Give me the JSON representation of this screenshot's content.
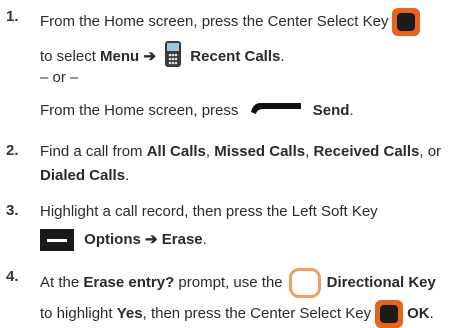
{
  "steps": [
    {
      "number": "1.",
      "line1": {
        "pre": "From the Home screen, press the Center Select Key"
      },
      "line2": {
        "pre": "to select ",
        "menu": "Menu",
        "arrow": "➔",
        "recent": "Recent Calls",
        "post": "."
      },
      "or": "– or –",
      "line4": {
        "pre": "From the Home screen, press",
        "send": "Send",
        "post": "."
      }
    },
    {
      "number": "2.",
      "line1": {
        "pre": "Find a call from ",
        "a": "All Calls",
        "c1": ", ",
        "b": "Missed Calls",
        "c2": ", ",
        "c": "Received Calls",
        "c3": ", or"
      },
      "line2": {
        "d": "Dialed Calls",
        "post": "."
      }
    },
    {
      "number": "3.",
      "line1": {
        "pre": "Highlight a call record, then press the Left Soft Key"
      },
      "line2": {
        "options": "Options",
        "arrow": "➔",
        "erase": "Erase",
        "post": "."
      }
    },
    {
      "number": "4.",
      "line1": {
        "pre": "At the ",
        "prompt": "Erase entry?",
        "mid": " prompt, use the",
        "dirkey": "Directional Key"
      },
      "line2": {
        "pre": "to highlight ",
        "yes": "Yes",
        "mid": ", then press the Center Select Key",
        "ok": "OK",
        "post": "."
      }
    }
  ],
  "icons": {
    "center_select": "center-select-key-icon",
    "phone": "phone-icon",
    "send": "send-key-icon",
    "soft": "left-soft-key-icon",
    "directional": "directional-key-icon"
  },
  "colors": {
    "key_orange": "#e8631c",
    "dir_orange": "#f0a05a",
    "text": "#2b2b2b"
  }
}
